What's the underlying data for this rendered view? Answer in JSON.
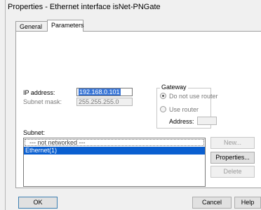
{
  "window": {
    "title": "Properties - Ethernet interface  isNet-PNGate"
  },
  "tabs": [
    {
      "label": "General",
      "active": false
    },
    {
      "label": "Parameters",
      "active": true
    }
  ],
  "ip": {
    "ip_label": "IP address:",
    "ip_value": "192.168.0.101",
    "mask_label": "Subnet mask:",
    "mask_value": "255.255.255.0"
  },
  "gateway": {
    "title": "Gateway",
    "option_no_router": "Do not use router",
    "option_use_router": "Use router",
    "address_label": "Address:",
    "address_value": "",
    "selected": "no_router"
  },
  "subnet": {
    "label": "Subnet:",
    "items": [
      "--- not networked ---",
      "Ethernet(1)"
    ],
    "selected_index": 1
  },
  "side_buttons": {
    "new": "New...",
    "properties": "Properties...",
    "delete": "Delete"
  },
  "footer": {
    "ok": "OK",
    "cancel": "Cancel",
    "help": "Help"
  },
  "colors": {
    "selection": "#0a5fd0",
    "background": "#f0f0f0"
  }
}
